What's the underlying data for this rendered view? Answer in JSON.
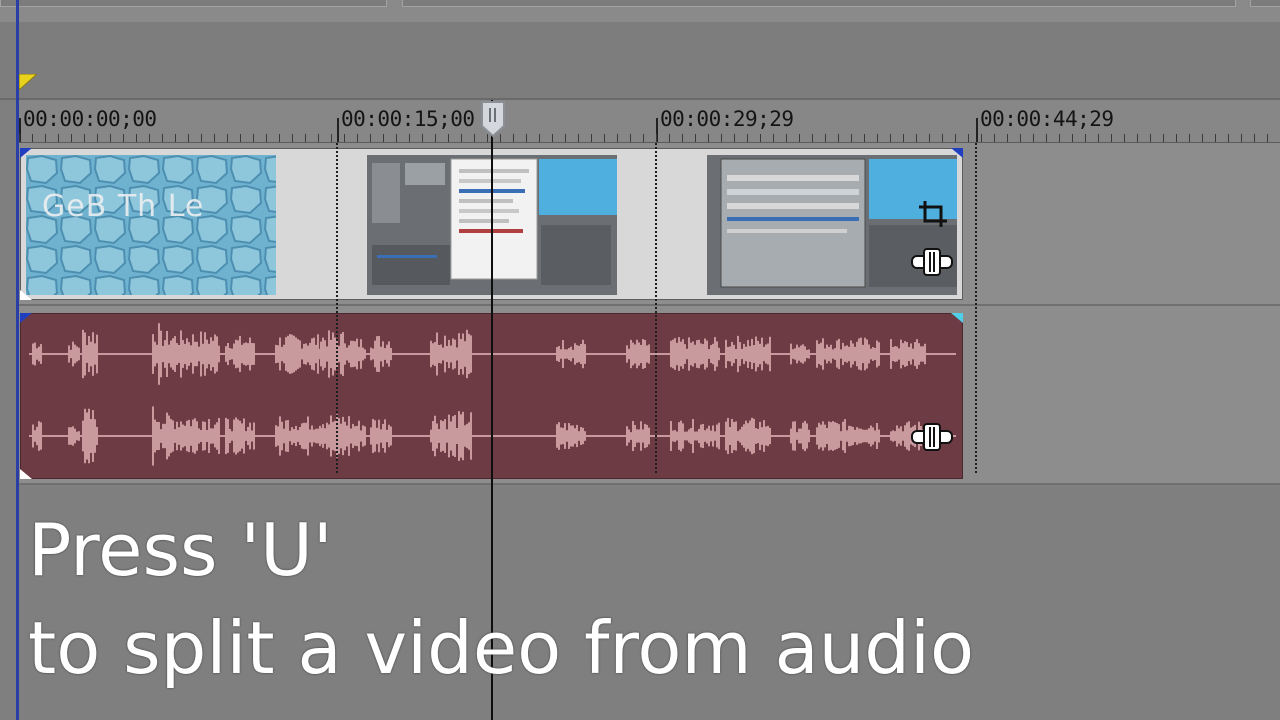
{
  "timeline": {
    "ruler_labels": [
      "00:00:00;00",
      "00:00:15;00",
      "00:00:29;29",
      "00:00:44;29"
    ],
    "playhead_time": "00:00:15;00"
  },
  "video_track": {
    "first_thumb_text": "GeB Th Le"
  },
  "caption": {
    "line1": "Press 'U'",
    "line2": "to split a video from audio"
  },
  "colors": {
    "audio_event": "#6d3b43",
    "waveform": "#c89a9e",
    "video_event": "#d8d8d8",
    "track_bg": "#8d8d8d"
  },
  "icons": [
    "loop-marker-icon",
    "crop-icon",
    "pan-event-icon",
    "playhead-handle-icon"
  ]
}
